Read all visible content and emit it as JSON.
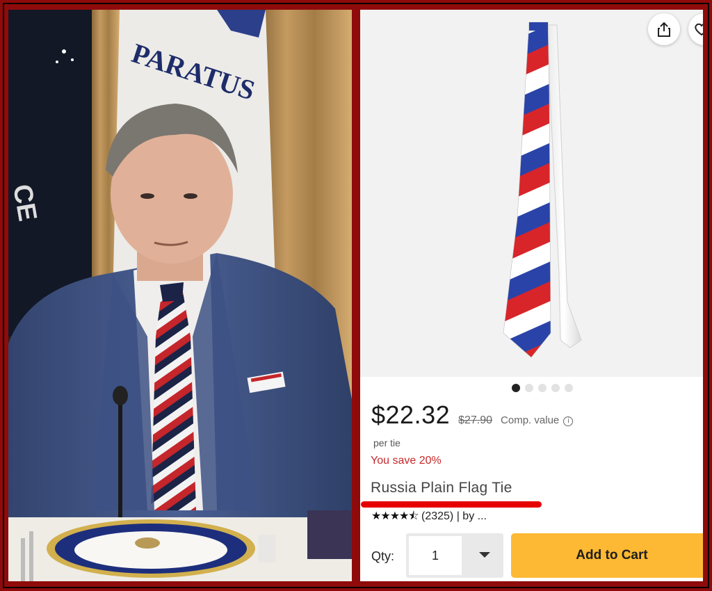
{
  "left_photo": {
    "flag_text": "PARATUS",
    "side_flag_text": "CE"
  },
  "product": {
    "price": "$22.32",
    "original_price": "$27.90",
    "comp_value_label": "Comp. value",
    "unit_label": "per tie",
    "savings_text": "You save 20%",
    "title": "Russia Plain Flag Tie",
    "rating_stars": "★★★★⯪",
    "rating_count": "(2325)",
    "byline": "| by ...",
    "image_count": 5,
    "active_image": 1
  },
  "cart": {
    "qty_label": "Qty:",
    "qty_value": "1",
    "add_to_cart_label": "Add to Cart"
  },
  "colors": {
    "frame": "#8f0b0b",
    "button": "#fdb933",
    "accent_red": "#e60000",
    "savings_red": "#c6282b",
    "stripe_red": "#d8252a",
    "stripe_blue": "#2a43a8"
  }
}
